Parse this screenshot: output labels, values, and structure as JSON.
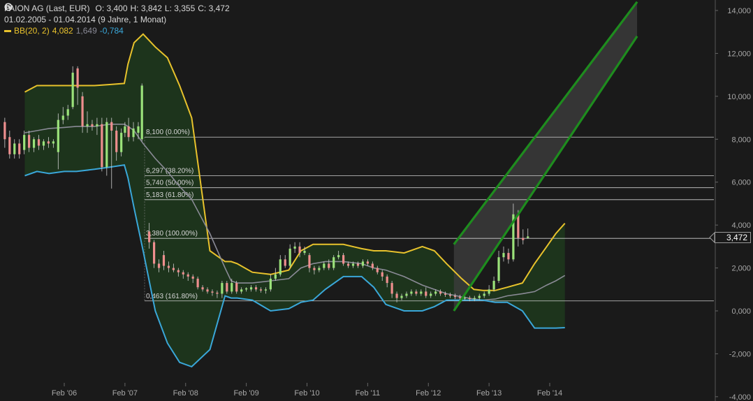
{
  "header": {
    "instrument": "PAION AG (Last, EUR)",
    "open": "O: 3,400",
    "high": "H: 3,842",
    "low": "L: 3,355",
    "close": "C: 3,472",
    "range": "01.02.2005 - 01.04.2014 (9 Jahre, 1 Monat)",
    "indicator": "BB(20, 2)",
    "indicator_upper": "4,082",
    "indicator_mid": "1,649",
    "indicator_lower": "-0,784",
    "last_price_tag": "3,472"
  },
  "colors": {
    "background": "#1a1a1a",
    "upper_band": "#e8c22c",
    "middle_band": "#8a8a96",
    "lower_band": "#3aa7d9",
    "band_fill": "#1f3a1d",
    "channel": "#1e8c1e",
    "candle_up": "#9be27a",
    "candle_down": "#ee8e8e",
    "grid_text": "#a8a8a8"
  },
  "chart_data": {
    "type": "candlestick",
    "y_axis": {
      "ylim": [
        -4,
        14.5
      ],
      "ticks": [
        "14,000",
        "12,000",
        "10,000",
        "8,000",
        "6,000",
        "4,000",
        "2,000",
        "0,000",
        "-2,000",
        "-4,000"
      ],
      "tick_values": [
        14,
        12,
        10,
        8,
        6,
        4,
        2,
        0,
        -2,
        -4
      ]
    },
    "x_axis": {
      "labels": [
        "Feb '06",
        "Feb '07",
        "Feb '08",
        "Feb '09",
        "Feb '10",
        "Feb '11",
        "Feb '12",
        "Feb '13",
        "Feb '14"
      ],
      "label_t": [
        1,
        2,
        3,
        4,
        5,
        6,
        7,
        8,
        9
      ],
      "tlim": [
        0,
        10.2
      ]
    },
    "fibonacci": [
      {
        "label": "8,100 (0.00%)",
        "value": 8.1
      },
      {
        "label": "6,297 (38.20%)",
        "value": 6.297
      },
      {
        "label": "5,740 (50.00%)",
        "value": 5.74
      },
      {
        "label": "5,183 (61.80%)",
        "value": 5.183
      },
      {
        "label": "3,380 (100.00%)",
        "value": 3.38
      },
      {
        "label": "0,463 (161.80%)",
        "value": 0.463
      }
    ],
    "channel": {
      "upper": [
        [
          7.42,
          3.1
        ],
        [
          10.44,
          14.4
        ]
      ],
      "lower": [
        [
          7.42,
          0.0
        ],
        [
          10.44,
          12.8
        ]
      ]
    },
    "bollinger": {
      "t": [
        0.35,
        0.55,
        0.75,
        1.0,
        1.2,
        1.5,
        1.75,
        1.99,
        2.05,
        2.15,
        2.3,
        2.5,
        2.7,
        2.9,
        3.1,
        3.4,
        3.65,
        3.75,
        3.85,
        4.1,
        4.4,
        4.7,
        4.9,
        5.1,
        5.3,
        5.6,
        5.9,
        6.1,
        6.3,
        6.6,
        6.9,
        7.1,
        7.3,
        7.55,
        7.75,
        7.9,
        8.1,
        8.3,
        8.55,
        8.75,
        8.95,
        9.1,
        9.25
      ],
      "upper": [
        10.2,
        10.5,
        10.5,
        10.5,
        10.5,
        10.5,
        10.55,
        10.6,
        11.5,
        12.5,
        12.9,
        12.3,
        11.8,
        10.5,
        9.0,
        2.8,
        2.3,
        2.3,
        2.2,
        1.8,
        1.7,
        1.9,
        2.8,
        3.1,
        3.1,
        3.1,
        2.9,
        2.8,
        2.8,
        2.7,
        3.0,
        2.8,
        2.2,
        1.5,
        1.0,
        0.95,
        0.95,
        1.1,
        1.3,
        2.2,
        3.0,
        3.6,
        4.08
      ],
      "mid": [
        8.3,
        8.4,
        8.5,
        8.55,
        8.6,
        8.6,
        8.7,
        8.7,
        8.6,
        8.4,
        7.8,
        7.1,
        6.5,
        5.8,
        5.2,
        3.6,
        2.0,
        1.4,
        1.3,
        1.3,
        1.4,
        1.5,
        2.0,
        2.2,
        2.3,
        2.3,
        2.2,
        2.0,
        1.9,
        1.6,
        1.2,
        1.0,
        0.8,
        0.65,
        0.55,
        0.5,
        0.55,
        0.7,
        0.8,
        0.9,
        1.2,
        1.4,
        1.65
      ],
      "lower": [
        6.3,
        6.5,
        6.4,
        6.5,
        6.5,
        6.6,
        6.7,
        6.8,
        6.2,
        4.8,
        2.8,
        0.0,
        -1.5,
        -2.4,
        -2.6,
        -1.8,
        0.7,
        0.6,
        0.6,
        0.5,
        0.0,
        0.1,
        0.4,
        0.5,
        1.0,
        1.6,
        1.6,
        1.1,
        0.3,
        0.0,
        0.0,
        0.2,
        0.5,
        0.5,
        0.5,
        0.5,
        0.4,
        0.4,
        0.0,
        -0.8,
        -0.8,
        -0.8,
        -0.78
      ]
    },
    "candles": [
      [
        0.02,
        8.8,
        8.0,
        9.0,
        7.6
      ],
      [
        0.1,
        8.1,
        7.3,
        8.4,
        7.1
      ],
      [
        0.18,
        7.3,
        7.8,
        8.0,
        7.1
      ],
      [
        0.26,
        7.8,
        7.3,
        8.0,
        7.1
      ],
      [
        0.34,
        7.5,
        8.2,
        8.4,
        7.3
      ],
      [
        0.42,
        8.2,
        7.6,
        8.4,
        7.4
      ],
      [
        0.5,
        7.6,
        8.0,
        8.1,
        7.4
      ],
      [
        0.58,
        8.0,
        7.7,
        8.2,
        7.5
      ],
      [
        0.66,
        7.7,
        7.9,
        8.0,
        7.5
      ],
      [
        0.74,
        7.9,
        7.8,
        8.1,
        7.6
      ],
      [
        0.82,
        7.8,
        7.9,
        8.0,
        7.6
      ],
      [
        0.9,
        7.4,
        8.9,
        9.2,
        6.6
      ],
      [
        0.98,
        8.9,
        9.1,
        9.5,
        8.7
      ],
      [
        1.06,
        9.1,
        9.4,
        9.6,
        8.9
      ],
      [
        1.14,
        9.5,
        11.1,
        11.4,
        9.4
      ],
      [
        1.22,
        11.3,
        10.4,
        11.4,
        9.6
      ],
      [
        1.3,
        10.0,
        8.6,
        10.2,
        8.3
      ],
      [
        1.38,
        8.6,
        8.7,
        9.3,
        8.3
      ],
      [
        1.46,
        8.7,
        8.6,
        8.9,
        8.4
      ],
      [
        1.54,
        8.6,
        8.7,
        9.0,
        8.2
      ],
      [
        1.62,
        8.7,
        6.7,
        9.0,
        6.5
      ],
      [
        1.7,
        6.7,
        8.8,
        9.0,
        6.3
      ],
      [
        1.78,
        8.8,
        8.4,
        9.0,
        5.7
      ],
      [
        1.86,
        8.4,
        7.4,
        8.6,
        7.0
      ],
      [
        1.94,
        7.4,
        8.3,
        8.5,
        7.2
      ],
      [
        2.0,
        8.3,
        8.6,
        8.8,
        8.1
      ],
      [
        2.06,
        8.6,
        8.1,
        9.0,
        7.9
      ],
      [
        2.14,
        8.1,
        8.5,
        8.8,
        7.9
      ],
      [
        2.22,
        8.3,
        8.6,
        8.8,
        8.0
      ],
      [
        2.28,
        8.0,
        10.5,
        10.6,
        7.9
      ],
      [
        2.4,
        3.7,
        3.2,
        4.1,
        2.9
      ],
      [
        2.48,
        3.2,
        2.2,
        3.3,
        2.0
      ],
      [
        2.56,
        2.2,
        2.0,
        2.4,
        1.8
      ],
      [
        2.64,
        2.6,
        2.1,
        2.8,
        1.9
      ],
      [
        2.72,
        2.1,
        2.0,
        2.3,
        1.8
      ],
      [
        2.8,
        2.0,
        1.9,
        2.2,
        1.8
      ],
      [
        2.88,
        1.9,
        1.8,
        2.0,
        1.6
      ],
      [
        2.96,
        1.8,
        1.7,
        1.9,
        1.5
      ],
      [
        3.04,
        1.7,
        1.6,
        1.8,
        1.4
      ],
      [
        3.12,
        1.6,
        1.5,
        1.7,
        1.3
      ],
      [
        3.2,
        1.5,
        1.1,
        1.6,
        1.0
      ],
      [
        3.28,
        1.1,
        1.0,
        1.2,
        0.9
      ],
      [
        3.36,
        1.0,
        0.9,
        1.1,
        0.8
      ],
      [
        3.44,
        0.9,
        0.85,
        1.0,
        0.7
      ],
      [
        3.52,
        0.85,
        0.8,
        0.95,
        0.6
      ],
      [
        3.6,
        0.8,
        1.3,
        1.4,
        0.6
      ],
      [
        3.68,
        1.3,
        0.9,
        1.4,
        0.8
      ],
      [
        3.76,
        0.9,
        1.3,
        1.5,
        0.8
      ],
      [
        3.84,
        1.3,
        0.9,
        1.4,
        0.8
      ],
      [
        3.92,
        0.9,
        1.0,
        1.1,
        0.8
      ],
      [
        4.0,
        1.0,
        1.05,
        1.1,
        0.9
      ],
      [
        4.08,
        1.0,
        1.1,
        1.2,
        0.9
      ],
      [
        4.16,
        1.1,
        1.0,
        1.2,
        0.9
      ],
      [
        4.24,
        1.0,
        0.95,
        1.1,
        0.85
      ],
      [
        4.32,
        0.95,
        1.0,
        1.1,
        0.8
      ],
      [
        4.4,
        1.0,
        1.5,
        1.7,
        0.9
      ],
      [
        4.48,
        1.5,
        1.7,
        2.0,
        1.4
      ],
      [
        4.56,
        1.7,
        2.4,
        2.6,
        1.6
      ],
      [
        4.64,
        2.4,
        2.1,
        2.6,
        2.0
      ],
      [
        4.72,
        2.1,
        2.9,
        3.1,
        2.0
      ],
      [
        4.8,
        2.9,
        3.0,
        3.2,
        2.7
      ],
      [
        4.88,
        3.0,
        2.7,
        3.2,
        2.5
      ],
      [
        4.96,
        2.7,
        2.8,
        3.0,
        2.6
      ],
      [
        5.04,
        2.6,
        2.0,
        2.7,
        1.8
      ],
      [
        5.12,
        2.0,
        1.9,
        2.1,
        1.7
      ],
      [
        5.2,
        1.9,
        2.0,
        2.1,
        1.8
      ],
      [
        5.28,
        2.0,
        2.2,
        2.3,
        1.9
      ],
      [
        5.36,
        2.2,
        2.0,
        2.4,
        1.9
      ],
      [
        5.44,
        2.0,
        2.5,
        2.6,
        1.9
      ],
      [
        5.52,
        2.5,
        2.6,
        2.8,
        2.4
      ],
      [
        5.6,
        2.6,
        2.2,
        2.7,
        2.1
      ],
      [
        5.68,
        2.2,
        2.1,
        2.3,
        2.0
      ],
      [
        5.76,
        2.1,
        2.2,
        2.3,
        2.0
      ],
      [
        5.84,
        2.2,
        2.1,
        2.3,
        2.0
      ],
      [
        5.92,
        2.1,
        2.3,
        2.4,
        2.0
      ],
      [
        6.0,
        2.3,
        2.2,
        2.4,
        2.1
      ],
      [
        6.08,
        2.2,
        2.0,
        2.3,
        1.9
      ],
      [
        6.16,
        2.0,
        1.8,
        2.1,
        1.7
      ],
      [
        6.24,
        1.8,
        1.6,
        1.9,
        1.4
      ],
      [
        6.32,
        1.6,
        1.3,
        1.7,
        1.1
      ],
      [
        6.4,
        1.3,
        0.8,
        1.4,
        0.6
      ],
      [
        6.48,
        0.8,
        0.6,
        0.9,
        0.4
      ],
      [
        6.56,
        0.6,
        0.7,
        0.8,
        0.5
      ],
      [
        6.64,
        0.7,
        0.8,
        0.9,
        0.6
      ],
      [
        6.72,
        0.8,
        0.9,
        1.0,
        0.7
      ],
      [
        6.8,
        0.9,
        0.8,
        1.0,
        0.7
      ],
      [
        6.88,
        0.8,
        0.9,
        1.0,
        0.7
      ],
      [
        6.96,
        0.9,
        0.7,
        1.1,
        0.6
      ],
      [
        7.04,
        0.7,
        0.8,
        0.9,
        0.6
      ],
      [
        7.12,
        0.8,
        0.9,
        1.0,
        0.7
      ],
      [
        7.2,
        0.9,
        0.8,
        1.0,
        0.7
      ],
      [
        7.28,
        0.8,
        0.75,
        0.9,
        0.65
      ],
      [
        7.36,
        0.75,
        0.7,
        0.85,
        0.6
      ],
      [
        7.44,
        0.7,
        0.65,
        0.8,
        0.55
      ],
      [
        7.52,
        0.65,
        0.6,
        0.75,
        0.5
      ],
      [
        7.6,
        0.6,
        0.6,
        0.7,
        0.5
      ],
      [
        7.68,
        0.6,
        0.55,
        0.7,
        0.45
      ],
      [
        7.76,
        0.55,
        0.6,
        0.7,
        0.45
      ],
      [
        7.84,
        0.6,
        0.7,
        0.8,
        0.5
      ],
      [
        7.92,
        0.7,
        0.8,
        0.9,
        0.6
      ],
      [
        8.0,
        0.8,
        1.0,
        1.2,
        0.7
      ],
      [
        8.08,
        1.0,
        1.4,
        1.6,
        0.9
      ],
      [
        8.16,
        1.4,
        2.5,
        2.8,
        1.3
      ],
      [
        8.24,
        2.5,
        2.7,
        3.0,
        2.3
      ],
      [
        8.32,
        2.7,
        2.4,
        2.9,
        2.2
      ],
      [
        8.4,
        2.4,
        4.5,
        5.0,
        2.3
      ],
      [
        8.48,
        4.5,
        3.4,
        4.7,
        3.0
      ],
      [
        8.56,
        3.4,
        3.3,
        3.8,
        3.1
      ],
      [
        8.64,
        3.4,
        3.47,
        3.84,
        3.36
      ]
    ]
  }
}
